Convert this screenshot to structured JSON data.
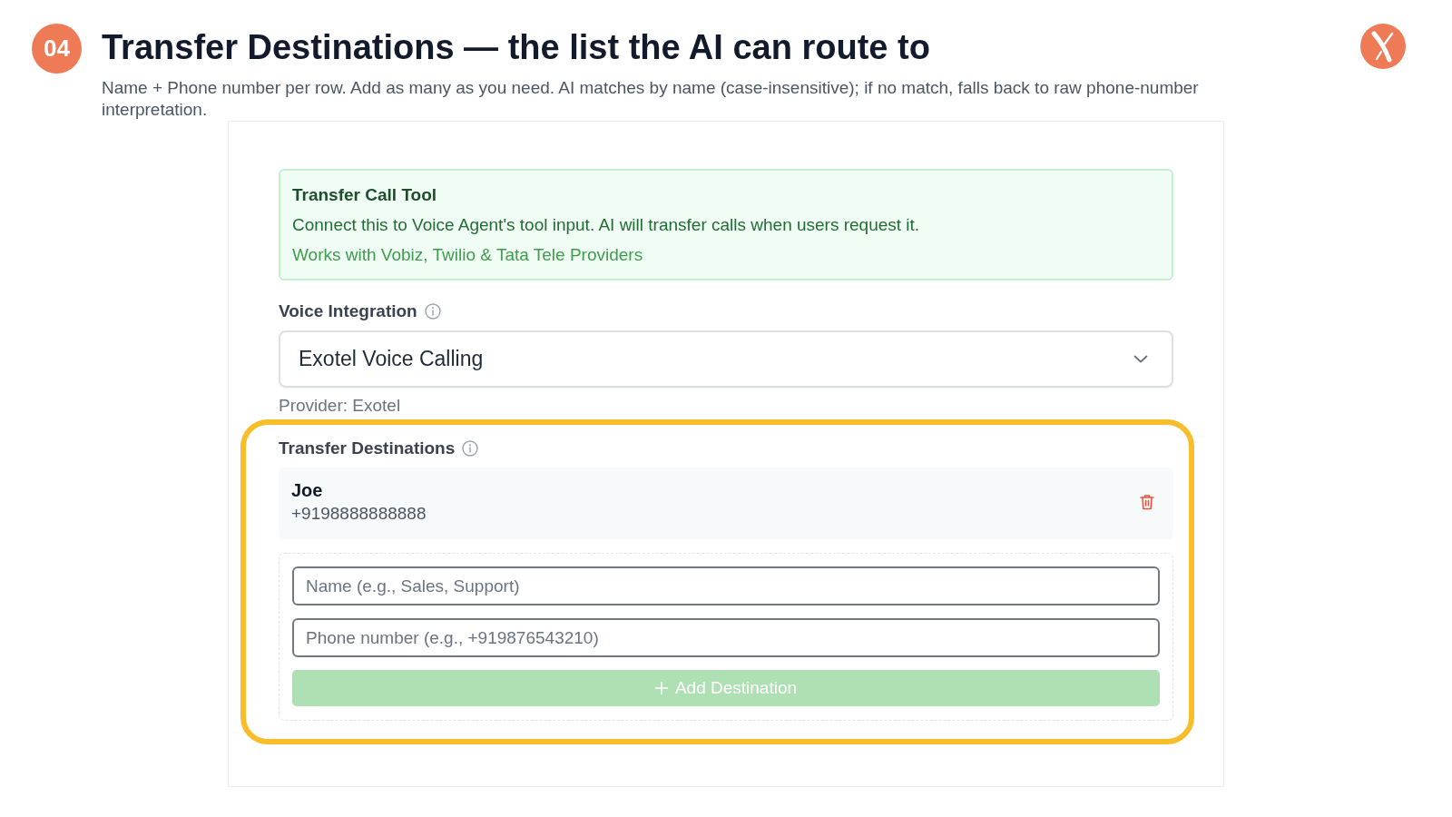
{
  "step_badge": "04",
  "title": "Transfer Destinations — the list the AI can route to",
  "subtitle": "Name + Phone number per row. Add as many as you need. AI matches by name (case-insensitive); if no match, falls back to raw phone-number interpretation.",
  "panel": {
    "info_banner": {
      "title": "Transfer Call Tool",
      "description": "Connect this to Voice Agent's tool input. AI will transfer calls when users request it.",
      "note": "Works with Vobiz, Twilio & Tata Tele Providers"
    },
    "voice_integration": {
      "label": "Voice Integration",
      "value": "Exotel Voice Calling",
      "provider_note": "Provider: Exotel"
    },
    "transfer_destinations": {
      "label": "Transfer Destinations",
      "highlighted": true,
      "destinations": [
        {
          "name": "Joe",
          "phone": "+9198888888888"
        }
      ],
      "new_destination": {
        "name_field": {
          "placeholder": "Name (e.g., Sales, Support)"
        },
        "phone_field": {
          "placeholder": "Phone number (e.g., +919876543210)"
        },
        "add_button": {
          "label": "Add Destination",
          "disabled": true
        }
      }
    }
  }
}
